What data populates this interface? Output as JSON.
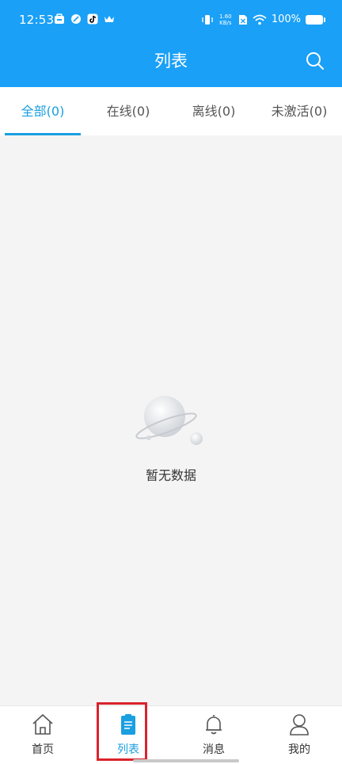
{
  "status_bar": {
    "time": "12:53",
    "network_speed": "1.60\nKB/s",
    "battery": "100%"
  },
  "header": {
    "title": "列表",
    "search_icon": "search-icon"
  },
  "tabs": [
    {
      "label": "全部(0)",
      "active": true
    },
    {
      "label": "在线(0)",
      "active": false
    },
    {
      "label": "离线(0)",
      "active": false
    },
    {
      "label": "未激活(0)",
      "active": false
    }
  ],
  "empty_state": {
    "illustration": "planet-illustration",
    "text": "暂无数据"
  },
  "bottom_nav": [
    {
      "label": "首页",
      "icon": "home-icon",
      "active": false
    },
    {
      "label": "列表",
      "icon": "clipboard-icon",
      "active": true
    },
    {
      "label": "消息",
      "icon": "bell-icon",
      "active": false
    },
    {
      "label": "我的",
      "icon": "user-icon",
      "active": false
    }
  ],
  "colors": {
    "primary": "#1aa0f7",
    "active_tab": "#1a9fe0",
    "background": "#f4f4f4",
    "highlight_box": "#d9232b"
  }
}
